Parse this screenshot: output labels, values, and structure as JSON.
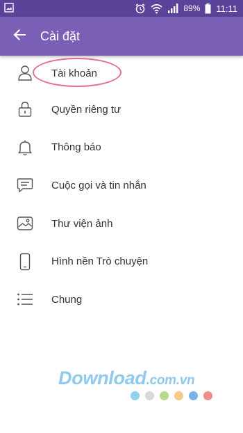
{
  "status_bar": {
    "battery": "89%",
    "time": "11:11",
    "icons": [
      "gallery-notification-icon",
      "alarm-icon",
      "wifi-icon",
      "signal-icon",
      "battery-icon"
    ]
  },
  "app_bar": {
    "title": "Cài đặt",
    "back_icon": "arrow-back-icon",
    "color": "#7a5fb7",
    "status_color": "#5a4399"
  },
  "settings": {
    "items": [
      {
        "label": "Tài khoản",
        "icon": "user-icon"
      },
      {
        "label": "Quyền riêng tư",
        "icon": "lock-icon"
      },
      {
        "label": "Thông báo",
        "icon": "bell-icon"
      },
      {
        "label": "Cuộc gọi và tin nhắn",
        "icon": "chat-icon"
      },
      {
        "label": "Thư viện ảnh",
        "icon": "gallery-icon"
      },
      {
        "label": "Hình nền Trò chuyện",
        "icon": "phone-icon"
      },
      {
        "label": "Chung",
        "icon": "list-icon"
      }
    ],
    "highlight_color": "#e0708a"
  },
  "watermark": {
    "brand": "Download",
    "suffix": ".com.vn",
    "dot_colors": [
      "#8dd3f0",
      "#d9d9d9",
      "#b4dc8c",
      "#f7c98b",
      "#7ab4e6",
      "#f08c8c"
    ]
  }
}
